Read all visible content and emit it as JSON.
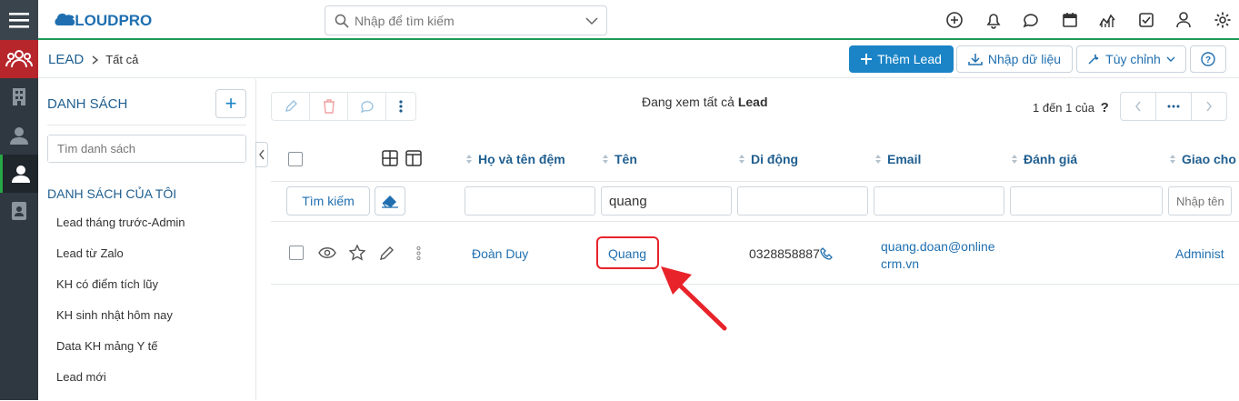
{
  "header": {
    "logo_text": "CLOUDPRO",
    "search_placeholder": "Nhập để tìm kiếm"
  },
  "breadcrumb": {
    "module": "LEAD",
    "current": "Tất cả"
  },
  "actions": {
    "add_label": "Thêm Lead",
    "import_label": "Nhập dữ liệu",
    "customize_label": "Tùy chỉnh"
  },
  "sidebar": {
    "title": "DANH SÁCH",
    "filter_placeholder": "Tìm danh sách",
    "my_lists_title": "DANH SÁCH CỦA TÔI",
    "items": [
      "Lead tháng trước-Admin",
      "Lead từ Zalo",
      "KH có điểm tích lũy",
      "KH sinh nhật hôm nay",
      "Data KH mảng Y tế",
      "Lead mới"
    ]
  },
  "list": {
    "viewing_prefix": "Đang xem tất cả",
    "viewing_module": "Lead",
    "pager_text": "1 đến 1 của",
    "pager_q": "?",
    "columns": [
      "Họ và tên đệm",
      "Tên",
      "Di động",
      "Email",
      "Đánh giá",
      "Giao cho"
    ],
    "search_button": "Tìm kiếm",
    "filters": {
      "ten": "quang",
      "giao_cho_placeholder": "Nhập tên"
    },
    "rows": [
      {
        "ho_ten_dem": "Đoàn Duy",
        "ten": "Quang",
        "di_dong": "0328858887",
        "email_line1": "quang.doan@online",
        "email_line2": "crm.vn",
        "danh_gia": "",
        "giao_cho": "Administ"
      }
    ]
  },
  "colors": {
    "primary": "#1a84c7",
    "link": "#1f6fb0",
    "heading": "#1f5e8f",
    "rail": "#2f3840",
    "rail_active_red": "#b7262b",
    "annotation": "#e8232a"
  }
}
